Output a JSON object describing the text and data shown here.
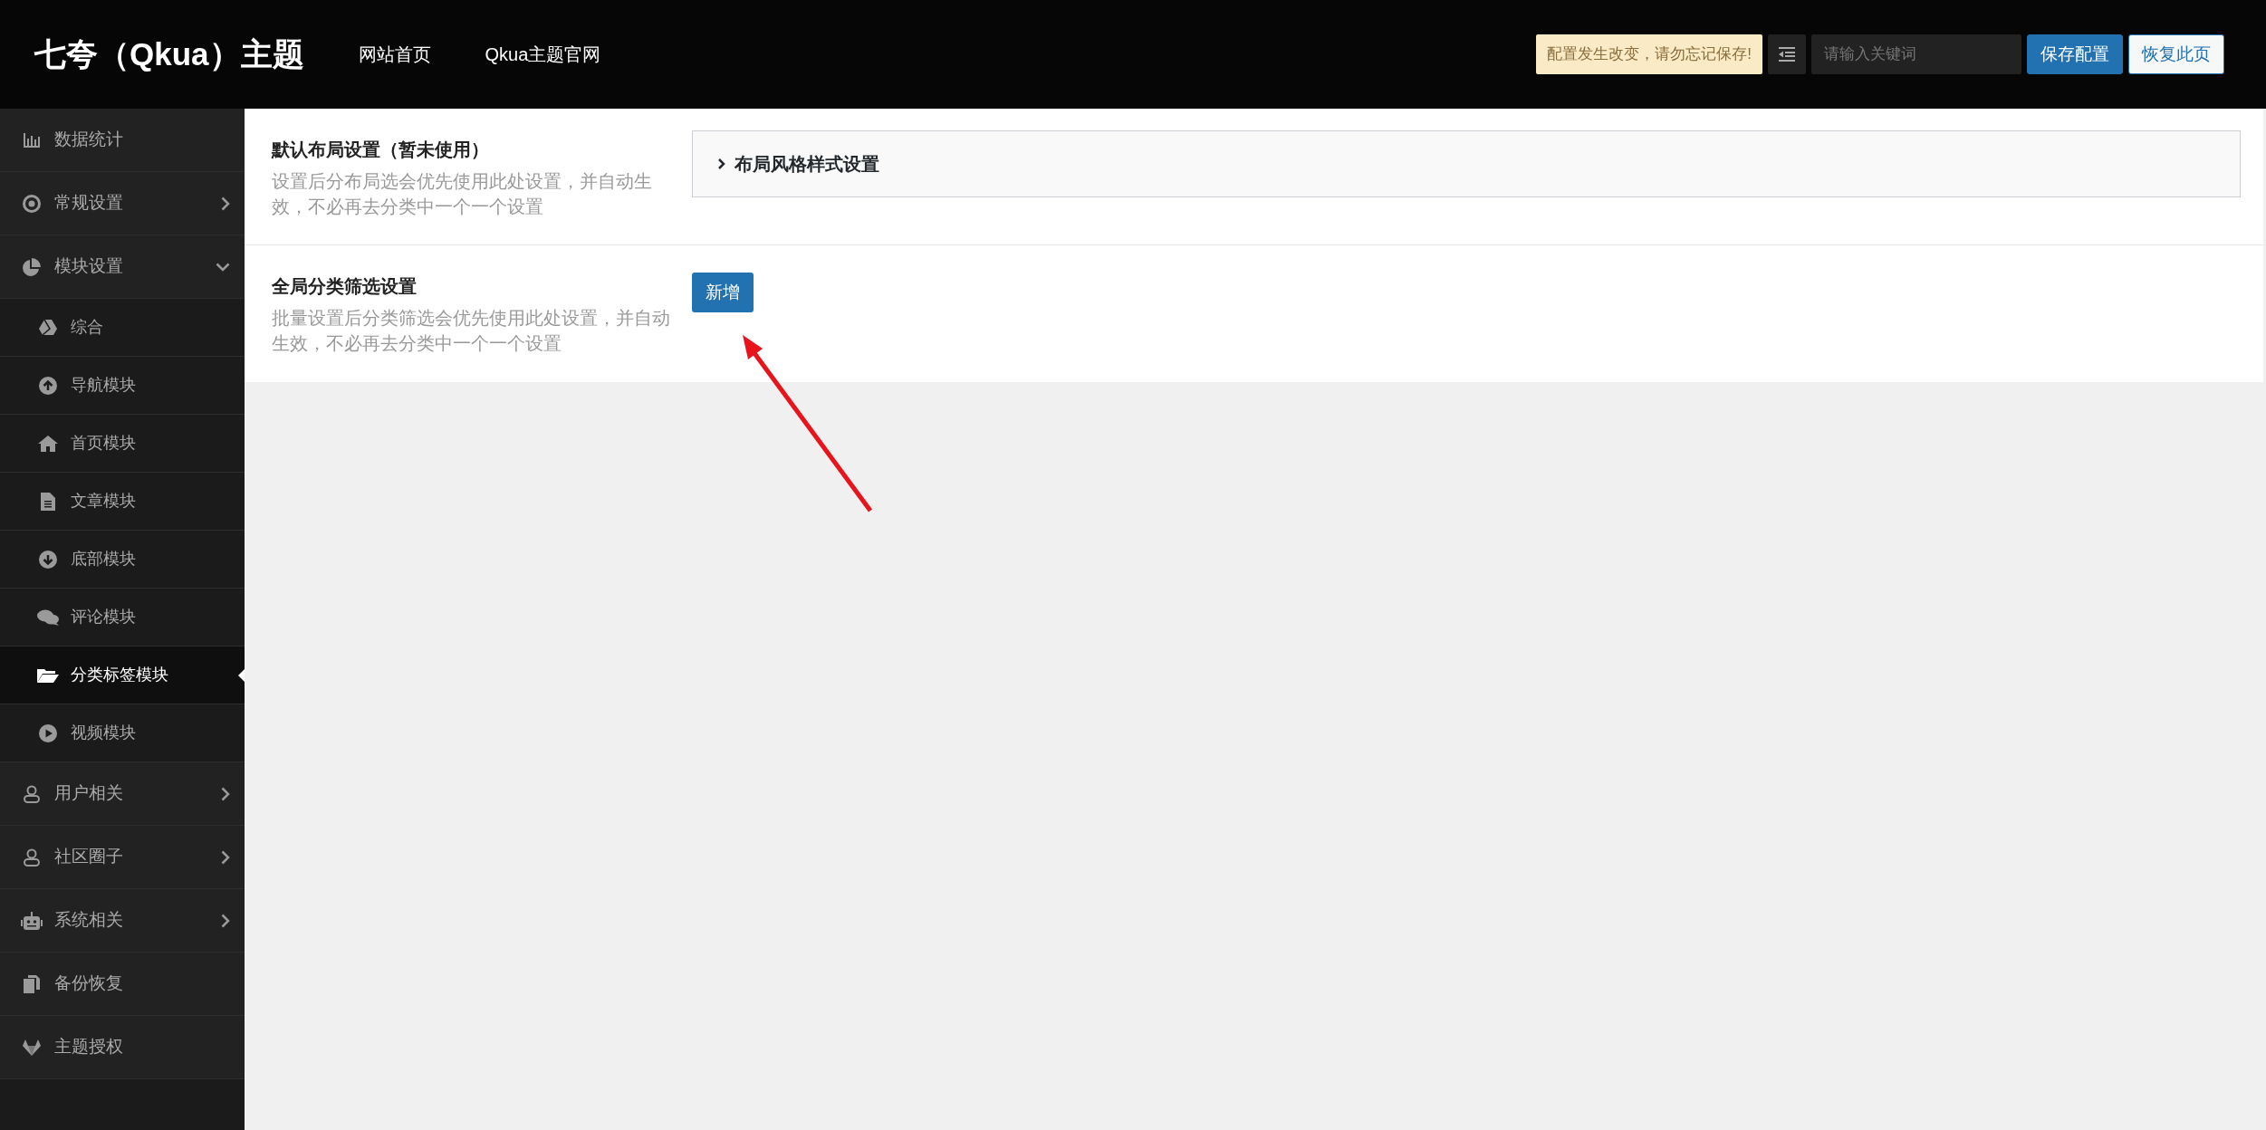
{
  "header": {
    "logo": "七夸（Qkua）主题",
    "nav_links": [
      "网站首页",
      "Qkua主题官网"
    ],
    "notice": "配置发生改变，请勿忘记保存!",
    "search": {
      "placeholder": "请输入关键词"
    },
    "buttons": [
      {
        "label": "保存配置",
        "kind": "primary"
      },
      {
        "label": "恢复此页",
        "kind": "secondary"
      }
    ]
  },
  "sidebar": {
    "items": [
      {
        "label": "数据统计",
        "selected": false
      },
      {
        "label": "常规设置",
        "selected": false,
        "expanded": false
      },
      {
        "label": "模块设置",
        "selected": false,
        "expanded": true,
        "children": [
          {
            "label": "综合",
            "selected": false
          },
          {
            "label": "导航模块",
            "selected": false
          },
          {
            "label": "首页模块",
            "selected": false
          },
          {
            "label": "文章模块",
            "selected": false
          },
          {
            "label": "底部模块",
            "selected": false
          },
          {
            "label": "评论模块",
            "selected": false
          },
          {
            "label": "分类标签模块",
            "selected": true
          },
          {
            "label": "视频模块",
            "selected": false
          }
        ]
      },
      {
        "label": "用户相关",
        "selected": false,
        "expanded": false
      },
      {
        "label": "社区圈子",
        "selected": false,
        "expanded": false
      },
      {
        "label": "系统相关",
        "selected": false,
        "expanded": false
      },
      {
        "label": "备份恢复",
        "selected": false
      },
      {
        "label": "主题授权",
        "selected": false
      }
    ]
  },
  "sections": [
    {
      "title": "默认布局设置（暂未使用）",
      "description": "设置后分布局选会优先使用此处设置，并自动生效，不必再去分类中一个一个设置",
      "control": {
        "kind": "accordion",
        "label": "布局风格样式设置",
        "expanded": false
      }
    },
    {
      "title": "全局分类筛选设置",
      "description": "批量设置后分类筛选会优先使用此处设置，并自动生效，不必再去分类中一个一个设置",
      "control": {
        "kind": "button",
        "label": "新增"
      }
    }
  ]
}
